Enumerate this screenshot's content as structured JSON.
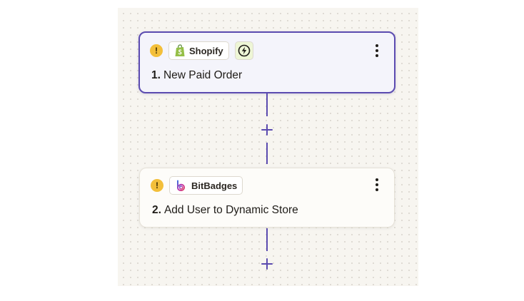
{
  "steps": [
    {
      "number": "1.",
      "title": "New Paid Order",
      "app": "Shopify",
      "icon": "shopify-bag-icon",
      "trigger_icon": "lightning-bolt-icon",
      "warning": true,
      "selected": true
    },
    {
      "number": "2.",
      "title": "Add User to Dynamic Store",
      "app": "BitBadges",
      "icon": "bitbadges-logo-icon",
      "warning": true,
      "selected": false
    }
  ],
  "colors": {
    "accent": "#5b4bb0",
    "warning": "#f3bf3a",
    "shopify_green": "#95bf47",
    "canvas": "#f7f5f0"
  }
}
